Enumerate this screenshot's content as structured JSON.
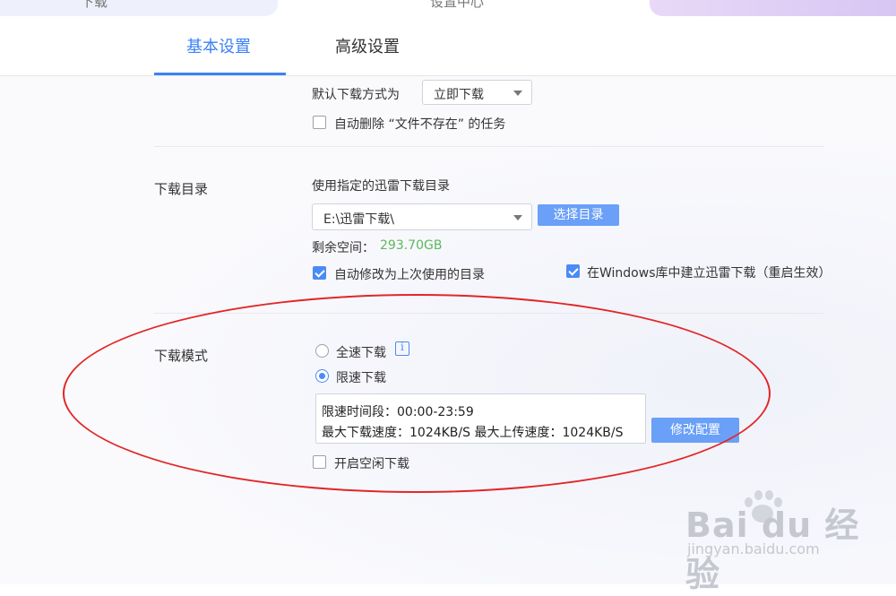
{
  "top": {
    "left_cut_text": "下载",
    "center_cut_text": "设置中心"
  },
  "tabs": [
    {
      "label": "基本设置",
      "active": true
    },
    {
      "label": "高级设置",
      "active": false
    }
  ],
  "download_mode_section": {
    "default_label": "默认下载方式为",
    "default_value": "立即下载",
    "auto_delete_label": "自动删除 “文件不存在” 的任务",
    "auto_delete_checked": false
  },
  "download_dir": {
    "title": "下载目录",
    "desc": "使用指定的迅雷下载目录",
    "path": "E:\\迅雷下载\\",
    "choose_button": "选择目录",
    "free_space_label": "剩余空间：",
    "free_space_value": "293.70GB",
    "auto_modify_label": "自动修改为上次使用的目录",
    "auto_modify_checked": true,
    "windows_lib_label": "在Windows库中建立迅雷下载（重启生效）",
    "windows_lib_checked": true
  },
  "download_speed_mode": {
    "title": "下载模式",
    "full_speed_label": "全速下载",
    "limit_speed_label": "限速下载",
    "selected": "limit",
    "time_range_line": "限速时间段：00:00-23:59",
    "speed_line": "最大下载速度：1024KB/S  最大上传速度：1024KB/S",
    "modify_button": "修改配置",
    "idle_download_label": "开启空闲下载",
    "idle_download_checked": false
  },
  "watermark": {
    "brand": "Bai du 经验",
    "url": "jingyan.baidu.com"
  },
  "colors": {
    "accent": "#3b82f6",
    "button": "#6aa0f7",
    "free_space": "#5cb85c",
    "annotation": "#e32626"
  }
}
